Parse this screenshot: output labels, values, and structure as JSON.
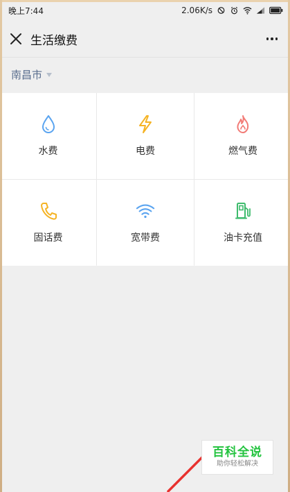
{
  "status_bar": {
    "time": "晚上7:44",
    "speed": "2.06K/s"
  },
  "header": {
    "title": "生活缴费"
  },
  "city": {
    "name": "南昌市"
  },
  "services": [
    {
      "label": "水费",
      "icon": "water-drop-icon",
      "color": "#5aa4f0"
    },
    {
      "label": "电费",
      "icon": "lightning-icon",
      "color": "#f5b324"
    },
    {
      "label": "燃气费",
      "icon": "flame-icon",
      "color": "#f27b76"
    },
    {
      "label": "固话费",
      "icon": "phone-icon",
      "color": "#f5b324"
    },
    {
      "label": "宽带费",
      "icon": "wifi-icon",
      "color": "#5aa4f0"
    },
    {
      "label": "油卡充值",
      "icon": "fuel-pump-icon",
      "color": "#3dbb6c"
    }
  ],
  "watermark": {
    "title": "百科全说",
    "subtitle": "助你轻松解决"
  }
}
